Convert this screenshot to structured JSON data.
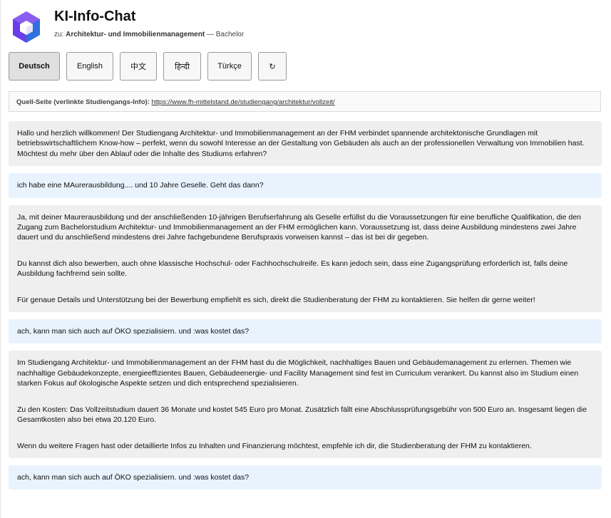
{
  "header": {
    "title": "KI-Info-Chat",
    "subtitle_prefix": "zu:",
    "program": "Architektur- und Immobilienmanagement",
    "separator": "—",
    "degree": "Bachelor"
  },
  "languages": [
    {
      "label": "Deutsch",
      "active": true
    },
    {
      "label": "English",
      "active": false
    },
    {
      "label": "中文",
      "active": false
    },
    {
      "label": "हिन्दी",
      "active": false
    },
    {
      "label": "Türkçe",
      "active": false
    },
    {
      "label": "↻",
      "active": false
    }
  ],
  "source": {
    "label": "Quell-Seite (verlinkte Studiengangs-Info):",
    "url": "https://www.fh-mittelstand.de/studiengang/architektur/vollzeit/"
  },
  "messages": [
    {
      "role": "bot",
      "paragraphs": [
        "Hallo und herzlich willkommen! Der Studiengang Architektur- und Immobilienmanagement an der FHM verbindet spannende architektonische Grundlagen mit betriebswirtschaftlichem Know-how – perfekt, wenn du sowohl Interesse an der Gestaltung von Gebäuden als auch an der professionellen Verwaltung von Immobilien hast. Möchtest du mehr über den Ablauf oder die Inhalte des Studiums erfahren?"
      ]
    },
    {
      "role": "user",
      "paragraphs": [
        "ich habe eine MAurerausbildung.... und 10 Jahre Geselle. Geht das dann?"
      ]
    },
    {
      "role": "bot",
      "paragraphs": [
        "Ja, mit deiner Maurerausbildung und der anschließenden 10-jährigen Berufserfahrung als Geselle erfüllst du die Voraussetzungen für eine berufliche Qualifikation, die den Zugang zum Bachelorstudium Architektur- und Immobilienmanagement an der FHM ermöglichen kann. Voraussetzung ist, dass deine Ausbildung mindestens zwei Jahre dauert und du anschließend mindestens drei Jahre fachgebundene Berufspraxis vorweisen kannst – das ist bei dir gegeben.",
        "Du kannst dich also bewerben, auch ohne klassische Hochschul- oder Fachhochschulreife. Es kann jedoch sein, dass eine Zugangsprüfung erforderlich ist, falls deine Ausbildung fachfremd sein sollte.",
        "Für genaue Details und Unterstützung bei der Bewerbung empfiehlt es sich, direkt die Studienberatung der FHM zu kontaktieren. Sie helfen dir gerne weiter!"
      ]
    },
    {
      "role": "user",
      "paragraphs": [
        "ach, kann man sich auch auf ÖKO spezialisiern. und :was kostet das?"
      ]
    },
    {
      "role": "bot",
      "paragraphs": [
        "Im Studiengang Architektur- und Immobilienmanagement an der FHM hast du die Möglichkeit, nachhaltiges Bauen und Gebäudemanagement zu erlernen. Themen wie nachhaltige Gebäudekonzepte, energieeffizientes Bauen, Gebäudeenergie- und Facility Management sind fest im Curriculum verankert. Du kannst also im Studium einen starken Fokus auf ökologische Aspekte setzen und dich entsprechend spezialisieren.",
        "Zu den Kosten: Das Vollzeitstudium dauert 36 Monate und kostet 545 Euro pro Monat. Zusätzlich fällt eine Abschlussprüfungsgebühr von 500 Euro an. Insgesamt liegen die Gesamtkosten also bei etwa 20.120 Euro.",
        "Wenn du weitere Fragen hast oder detaillierte Infos zu Inhalten und Finanzierung möchtest, empfehle ich dir, die Studienberatung der FHM zu kontaktieren."
      ]
    },
    {
      "role": "user",
      "paragraphs": [
        "ach, kann man sich auch auf ÖKO spezialisiern. und :was kostet das?"
      ]
    }
  ],
  "colors": {
    "bot_bubble": "#efefef",
    "user_bubble": "#e8f3fd",
    "logo_primary": "#6a3de8",
    "logo_secondary": "#2f6fe0"
  },
  "icons": {
    "logo": "hexagon-cube-logo",
    "refresh": "refresh-icon"
  }
}
